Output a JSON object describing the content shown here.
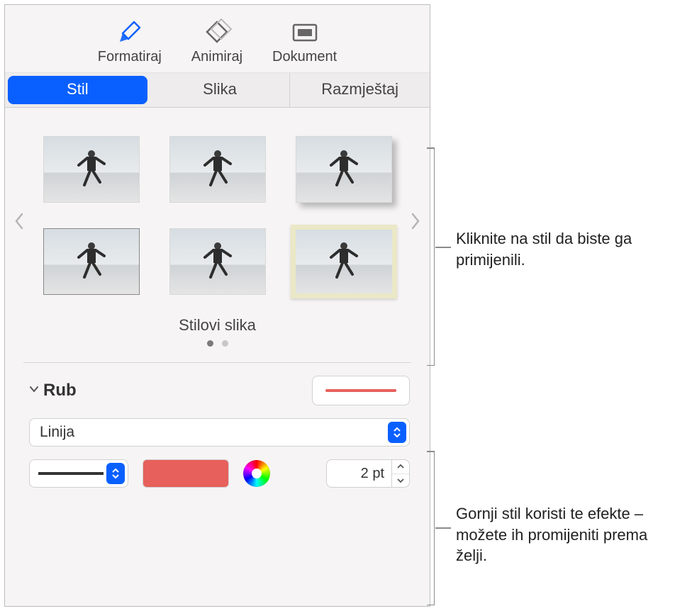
{
  "toolbar": {
    "format": "Formatiraj",
    "animate": "Animiraj",
    "document": "Dokument"
  },
  "tabs": {
    "style": "Stil",
    "image": "Slika",
    "arrange": "Razmještaj"
  },
  "styles": {
    "caption": "Stilovi slika"
  },
  "border": {
    "title": "Rub",
    "type_label": "Linija",
    "width_value": "2 pt",
    "color": "#e7605b"
  },
  "callouts": {
    "apply_style": "Kliknite na stil da biste ga primijenili.",
    "edit_effects": "Gornji stil koristi te efekte – možete ih promijeniti prema želji."
  }
}
